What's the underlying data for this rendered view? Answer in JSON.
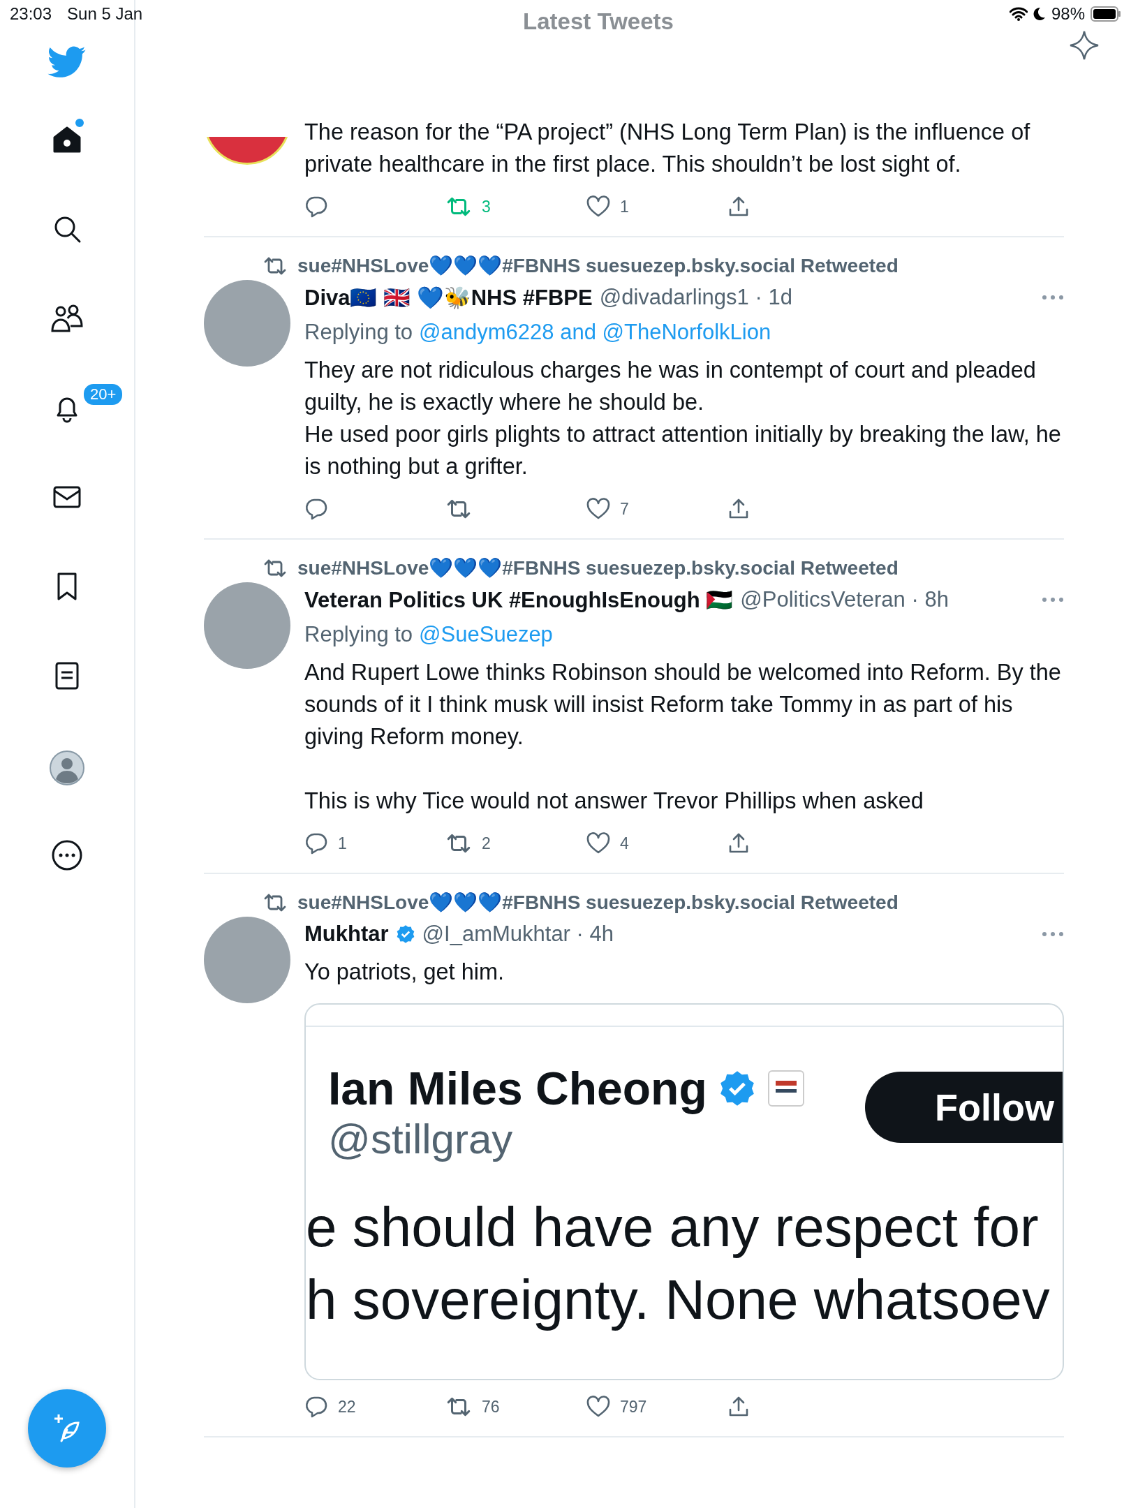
{
  "status_bar": {
    "time": "23:03",
    "date": "Sun 5 Jan",
    "battery": "98%"
  },
  "header": {
    "title": "Latest Tweets"
  },
  "sidebar": {
    "items": [
      {
        "kind": "home",
        "selected": true,
        "dot": true
      },
      {
        "kind": "search",
        "selected": false
      },
      {
        "kind": "people",
        "selected": false
      },
      {
        "kind": "bell",
        "selected": false,
        "badge": "20+"
      },
      {
        "kind": "mail",
        "selected": false
      },
      {
        "kind": "bookmark",
        "selected": false
      },
      {
        "kind": "list",
        "selected": false
      },
      {
        "kind": "profile",
        "selected": false
      },
      {
        "kind": "more",
        "selected": false
      }
    ]
  },
  "tweets": [
    {
      "body": "The reason for the “PA project” (NHS Long Term Plan) is the influence of private healthcare in the first place. This shouldn’t be lost sight of.",
      "actions": {
        "retweets": "3",
        "likes": "1",
        "retweeted": true,
        "liked": false
      }
    },
    {
      "retweeted_by": "sue#NHSLove💙💙💙#FBNHS suesuezep.bsky.social Retweeted",
      "name": "Diva🇪🇺 🇬🇧 💙🐝NHS #FBPE",
      "verified": false,
      "meta": "@divadarlings1 · 1d",
      "replying_label": "Replying to",
      "replying_to": "@andym6228 and @TheNorfolkLion",
      "body": "They are not ridiculous charges he was in contempt of court and pleaded guilty, he is exactly where he should be.\nHe used poor girls plights to attract attention initially by breaking the law, he is nothing but a grifter.",
      "actions": {
        "likes": "7",
        "retweeted": false,
        "liked": false
      }
    },
    {
      "retweeted_by": "sue#NHSLove💙💙💙#FBNHS suesuezep.bsky.social Retweeted",
      "name": "Veteran Politics UK #EnoughIsEnough 🇵🇸",
      "verified": false,
      "meta": "@PoliticsVeteran · 8h",
      "replying_label": "Replying to",
      "replying_to": "@SueSuezep",
      "body": "And Rupert Lowe thinks Robinson should be welcomed into Reform. By the sounds of it I think musk will insist Reform take Tommy in as part of his giving Reform money.\n\nThis is why Tice would not answer Trevor Phillips when asked",
      "actions": {
        "replies": "1",
        "retweets": "2",
        "likes": "4",
        "retweeted": false,
        "liked": false
      }
    },
    {
      "retweeted_by": "sue#NHSLove💙💙💙#FBNHS suesuezep.bsky.social Retweeted",
      "name": "Mukhtar",
      "verified": true,
      "meta": "@I_amMukhtar · 4h",
      "body": "Yo patriots, get him.",
      "quote": {
        "name": "Ian Miles Cheong",
        "verified": true,
        "handle": "@stillgray",
        "button": "Follow",
        "lines": [
          "e should have any respect for",
          "h sovereignty. None whatsoev"
        ]
      },
      "actions": {
        "replies": "22",
        "retweets": "76",
        "likes": "797",
        "retweeted": false,
        "liked": false
      }
    }
  ]
}
